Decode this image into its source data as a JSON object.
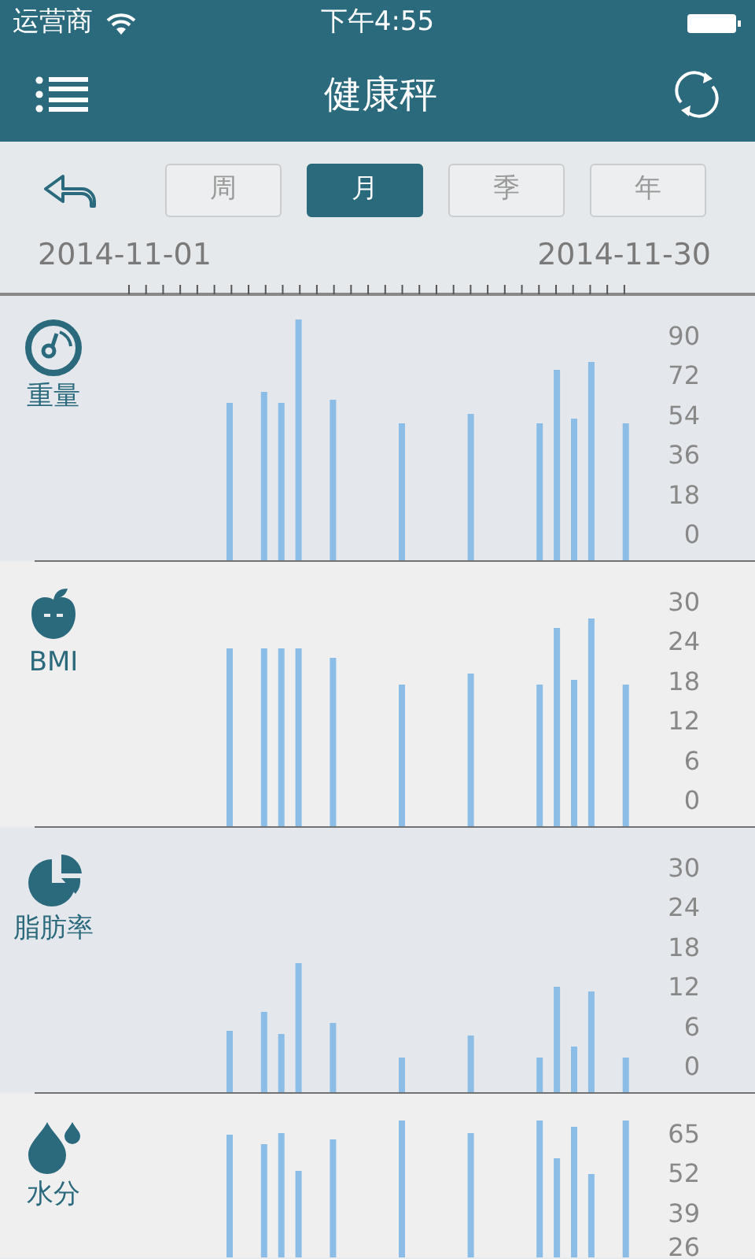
{
  "status_bar": {
    "carrier": "运营商",
    "time": "下午4:55"
  },
  "header": {
    "title": "健康秤"
  },
  "period_tabs": [
    {
      "label": "周",
      "selected": false
    },
    {
      "label": "月",
      "selected": true
    },
    {
      "label": "季",
      "selected": false
    },
    {
      "label": "年",
      "selected": false
    }
  ],
  "date_range": {
    "start": "2014-11-01",
    "end": "2014-11-30"
  },
  "metrics": [
    {
      "kind": "weight",
      "label": "重量",
      "axis_labels": [
        "90",
        "72",
        "54",
        "36",
        "18",
        "0"
      ]
    },
    {
      "kind": "bmi",
      "label": "BMI",
      "axis_labels": [
        "30",
        "24",
        "18",
        "12",
        "6",
        "0"
      ]
    },
    {
      "kind": "fat",
      "label": "脂肪率",
      "axis_labels": [
        "30",
        "24",
        "18",
        "12",
        "6",
        "0"
      ]
    },
    {
      "kind": "water",
      "label": "水分",
      "axis_labels": [
        "65",
        "52",
        "39",
        "26"
      ]
    }
  ]
}
